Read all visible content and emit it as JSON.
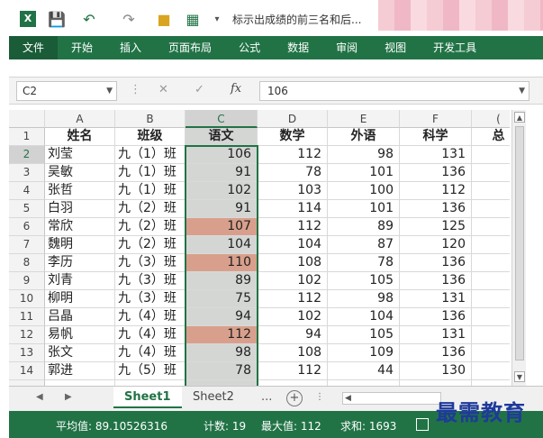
{
  "titlebar": {
    "app_icon": "excel-icon",
    "title": "标示出成绩的前三名和后..."
  },
  "ribbon": {
    "tabs": [
      "文件",
      "开始",
      "插入",
      "页面布局",
      "公式",
      "数据",
      "审阅",
      "视图",
      "开发工具"
    ]
  },
  "formula_bar": {
    "name_box": "C2",
    "fx_label": "fx",
    "value": "106"
  },
  "columns": [
    "A",
    "B",
    "C",
    "D",
    "E",
    "F",
    "("
  ],
  "header_row": [
    "姓名",
    "班级",
    "语文",
    "数学",
    "外语",
    "科学",
    "总"
  ],
  "rows": [
    {
      "n": "1"
    },
    {
      "n": "2",
      "name": "刘莹",
      "class": "九（1）班",
      "c": "106",
      "d": "112",
      "e": "98",
      "f": "131"
    },
    {
      "n": "3",
      "name": "吴敏",
      "class": "九（1）班",
      "c": "91",
      "d": "78",
      "e": "101",
      "f": "136"
    },
    {
      "n": "4",
      "name": "张哲",
      "class": "九（1）班",
      "c": "102",
      "d": "103",
      "e": "100",
      "f": "112"
    },
    {
      "n": "5",
      "name": "白羽",
      "class": "九（2）班",
      "c": "91",
      "d": "114",
      "e": "101",
      "f": "136"
    },
    {
      "n": "6",
      "name": "常欣",
      "class": "九（2）班",
      "c": "107",
      "d": "112",
      "e": "89",
      "f": "125"
    },
    {
      "n": "7",
      "name": "魏明",
      "class": "九（2）班",
      "c": "104",
      "d": "104",
      "e": "87",
      "f": "120"
    },
    {
      "n": "8",
      "name": "李历",
      "class": "九（3）班",
      "c": "110",
      "d": "108",
      "e": "78",
      "f": "136"
    },
    {
      "n": "9",
      "name": "刘青",
      "class": "九（3）班",
      "c": "89",
      "d": "102",
      "e": "105",
      "f": "136"
    },
    {
      "n": "10",
      "name": "柳明",
      "class": "九（3）班",
      "c": "75",
      "d": "112",
      "e": "98",
      "f": "131"
    },
    {
      "n": "11",
      "name": "吕晶",
      "class": "九（4）班",
      "c": "94",
      "d": "102",
      "e": "104",
      "f": "136"
    },
    {
      "n": "12",
      "name": "易帆",
      "class": "九（4）班",
      "c": "112",
      "d": "94",
      "e": "105",
      "f": "131"
    },
    {
      "n": "13",
      "name": "张文",
      "class": "九（4）班",
      "c": "98",
      "d": "108",
      "e": "109",
      "f": "136"
    },
    {
      "n": "14",
      "name": "郭进",
      "class": "九（5）班",
      "c": "78",
      "d": "112",
      "e": "44",
      "f": "130"
    }
  ],
  "highlight_color": "#d8a08c",
  "sheets": {
    "tabs": [
      "Sheet1",
      "Sheet2"
    ],
    "more": "...",
    "add": "+"
  },
  "status": {
    "average": "平均值: 89.10526316",
    "count": "计数: 19",
    "max": "最大值: 112",
    "sum": "求和: 1693"
  },
  "watermark": "最需教育"
}
